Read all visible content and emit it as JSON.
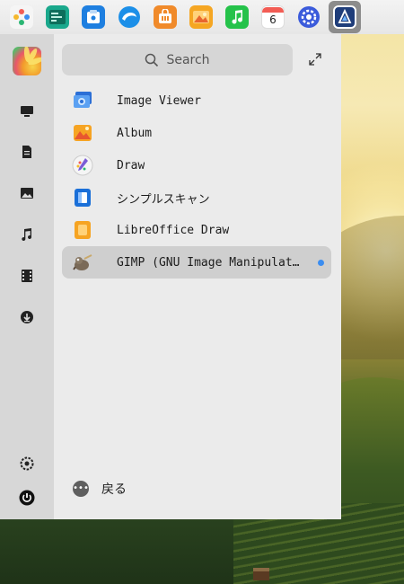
{
  "dock": {
    "items": [
      {
        "name": "pinwheel-app-icon",
        "color": "#f0f0f0"
      },
      {
        "name": "terminal-app-icon",
        "color": "#1aa88c"
      },
      {
        "name": "installer-app-icon",
        "color": "#1e7fe0"
      },
      {
        "name": "browser-app-icon",
        "color": "#1c8fe8"
      },
      {
        "name": "store-app-icon",
        "color": "#f08a2a"
      },
      {
        "name": "photos-app-icon",
        "color": "#f5a623"
      },
      {
        "name": "music-app-icon",
        "color": "#25c24a"
      },
      {
        "name": "calendar-app-icon",
        "color": "#ffffff",
        "text": "6"
      },
      {
        "name": "settings-app-icon",
        "color": "#3b5bdb"
      },
      {
        "name": "launcher-app-icon",
        "color": "#2a4fa0",
        "active": true
      }
    ]
  },
  "search": {
    "placeholder": "Search"
  },
  "apps": [
    {
      "label": "Image Viewer",
      "icon": "image-viewer-icon"
    },
    {
      "label": "Album",
      "icon": "album-icon"
    },
    {
      "label": "Draw",
      "icon": "draw-icon"
    },
    {
      "label": "シンプルスキャン",
      "icon": "simple-scan-icon"
    },
    {
      "label": "LibreOffice Draw",
      "icon": "libreoffice-draw-icon"
    },
    {
      "label": "GIMP (GNU Image Manipulation Program)",
      "icon": "gimp-icon",
      "selected": true
    }
  ],
  "back": {
    "label": "戻る"
  },
  "colors": {
    "accent": "#3b8df0",
    "panel": "#ebebeb",
    "sidebar": "#d7d7d7"
  }
}
